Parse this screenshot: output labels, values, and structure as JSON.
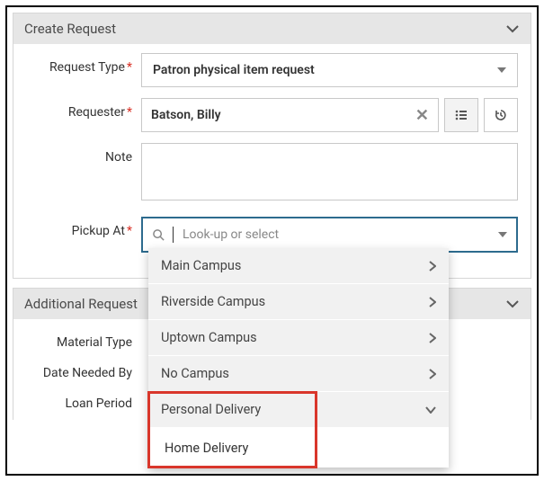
{
  "panel1": {
    "title": "Create Request",
    "request_type": {
      "label": "Request Type",
      "value": "Patron physical item request"
    },
    "requester": {
      "label": "Requester",
      "value": "Batson, Billy"
    },
    "note": {
      "label": "Note",
      "value": ""
    },
    "pickup": {
      "label": "Pickup At",
      "placeholder": "Look-up or select"
    }
  },
  "panel2": {
    "title": "Additional Request",
    "material_type": {
      "label": "Material Type"
    },
    "date_needed": {
      "label": "Date Needed By"
    },
    "loan_period": {
      "label": "Loan Period"
    }
  },
  "dropdown": {
    "items": [
      {
        "label": "Main Campus",
        "expandable": true
      },
      {
        "label": "Riverside Campus",
        "expandable": true
      },
      {
        "label": "Uptown Campus",
        "expandable": true
      },
      {
        "label": "No Campus",
        "expandable": true
      },
      {
        "label": "Personal Delivery",
        "expandable": true,
        "expanded": true
      }
    ],
    "sub": {
      "label": "Home Delivery"
    }
  }
}
